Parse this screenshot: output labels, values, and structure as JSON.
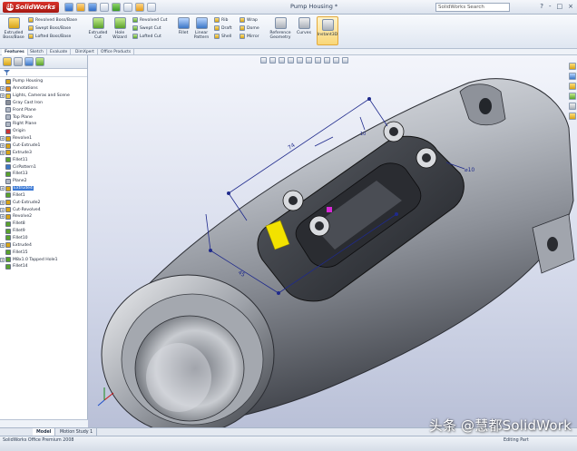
{
  "app": {
    "brand": "SolidWorks",
    "document_title": "Pump Housing *",
    "search_placeholder": "SolidWorks Search",
    "window_buttons": [
      "?",
      "-",
      "□",
      "×"
    ]
  },
  "ribbon": {
    "extruded_boss": "Extruded Boss/Base",
    "revolved_boss": "Revolved Boss/Base",
    "swept_boss": "Swept Boss/Base",
    "lofted_boss": "Lofted Boss/Base",
    "extruded_cut": "Extruded Cut",
    "hole_wizard": "Hole Wizard",
    "revolved_cut": "Revolved Cut",
    "swept_cut": "Swept Cut",
    "lofted_cut": "Lofted Cut",
    "fillet": "Fillet",
    "linear_pattern": "Linear Pattern",
    "rib": "Rib",
    "draft": "Draft",
    "shell": "Shell",
    "wrap": "Wrap",
    "dome": "Dome",
    "mirror": "Mirror",
    "reference_geometry": "Reference Geometry",
    "curves": "Curves",
    "instant3d": "Instant3D"
  },
  "command_tabs": [
    "Features",
    "Sketch",
    "Evaluate",
    "DimXpert",
    "Office Products"
  ],
  "feature_tree": [
    {
      "label": "Pump Housing",
      "icon": "part-icon",
      "expand": ""
    },
    {
      "label": "Annotations",
      "icon": "annotations-icon",
      "expand": "+"
    },
    {
      "label": "Lights, Cameras and Scene",
      "icon": "lights-icon",
      "expand": "+"
    },
    {
      "label": "Gray Cast Iron",
      "icon": "material-icon",
      "expand": ""
    },
    {
      "label": "Front Plane",
      "icon": "plane-icon",
      "expand": ""
    },
    {
      "label": "Top Plane",
      "icon": "plane-icon",
      "expand": ""
    },
    {
      "label": "Right Plane",
      "icon": "plane-icon",
      "expand": ""
    },
    {
      "label": "Origin",
      "icon": "origin-icon",
      "expand": ""
    },
    {
      "label": "Revolve1",
      "icon": "feature-icon",
      "expand": "+"
    },
    {
      "label": "Cut-Extrude1",
      "icon": "feature-icon",
      "expand": "+"
    },
    {
      "label": "Extrude3",
      "icon": "feature-icon",
      "expand": "+"
    },
    {
      "label": "Fillet11",
      "icon": "fillet-icon",
      "expand": ""
    },
    {
      "label": "CirPattern1",
      "icon": "pattern-icon",
      "expand": ""
    },
    {
      "label": "Fillet13",
      "icon": "fillet-icon",
      "expand": ""
    },
    {
      "label": "Plane2",
      "icon": "plane-icon",
      "expand": ""
    },
    {
      "label": "Extrude4",
      "icon": "feature-icon",
      "expand": "+",
      "selected": true
    },
    {
      "label": "Fillet1",
      "icon": "fillet-icon",
      "expand": ""
    },
    {
      "label": "Cut-Extrude2",
      "icon": "feature-icon",
      "expand": "+"
    },
    {
      "label": "Cut-Revolve4",
      "icon": "feature-icon",
      "expand": "+"
    },
    {
      "label": "Revolve2",
      "icon": "feature-icon",
      "expand": "+"
    },
    {
      "label": "Fillet8",
      "icon": "fillet-icon",
      "expand": ""
    },
    {
      "label": "Fillet9",
      "icon": "fillet-icon",
      "expand": ""
    },
    {
      "label": "Fillet10",
      "icon": "fillet-icon",
      "expand": ""
    },
    {
      "label": "Extrude4",
      "icon": "feature-icon",
      "expand": "+"
    },
    {
      "label": "Fillet15",
      "icon": "fillet-icon",
      "expand": ""
    },
    {
      "label": "M8x1.0 Tapped Hole1",
      "icon": "hole-icon",
      "expand": "+"
    },
    {
      "label": "Fillet14",
      "icon": "fillet-icon",
      "expand": ""
    }
  ],
  "viewport": {
    "dim_length": "74",
    "dim_diameter": "⌀10",
    "dim_small": "10",
    "dim_bottom": "45"
  },
  "model_tabs": [
    "Model",
    "Motion Study 1"
  ],
  "status": {
    "left": "SolidWorks Office Premium 2008",
    "right": "Editing Part"
  },
  "watermark": "头条 @慧都SolidWork",
  "colors": {
    "accent": "#3a78d4",
    "brand_red": "#c0251c",
    "highlight_yellow": "#f2e200",
    "dimension_blue": "#1f2a8c"
  }
}
